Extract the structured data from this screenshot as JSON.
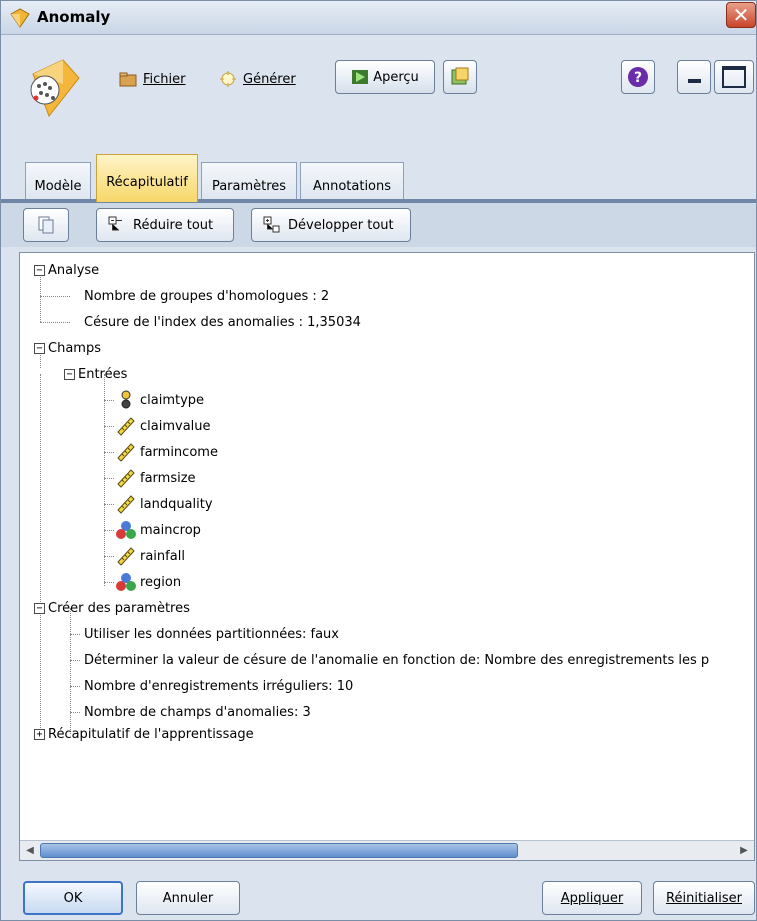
{
  "window": {
    "title": "Anomaly"
  },
  "menu": {
    "file": "Fichier",
    "generate": "Générer",
    "preview": "Aperçu"
  },
  "tabs": [
    {
      "label": "Modèle"
    },
    {
      "label": "Récapitulatif"
    },
    {
      "label": "Paramètres"
    },
    {
      "label": "Annotations"
    }
  ],
  "actions": {
    "collapse_all": "Réduire tout",
    "expand_all": "Développer tout"
  },
  "tree": {
    "analysis": "Analyse",
    "peer_groups": "Nombre de groupes d'homologues : 2",
    "cutoff": "Césure de l'index des anomalies : 1,35034",
    "fields": "Champs",
    "inputs": "Entrées",
    "field_items": [
      {
        "name": "claimtype",
        "icon": "flag-icon"
      },
      {
        "name": "claimvalue",
        "icon": "ruler-icon"
      },
      {
        "name": "farmincome",
        "icon": "ruler-icon"
      },
      {
        "name": "farmsize",
        "icon": "ruler-icon"
      },
      {
        "name": "landquality",
        "icon": "ruler-icon"
      },
      {
        "name": "maincrop",
        "icon": "set-icon"
      },
      {
        "name": "rainfall",
        "icon": "ruler-icon"
      },
      {
        "name": "region",
        "icon": "set-icon"
      }
    ],
    "build_settings": "Créer des paramètres",
    "settings": [
      "Utiliser les données partitionnées: faux",
      "Déterminer la valeur de césure de l'anomalie en fonction de: Nombre des enregistrements les p",
      "Nombre d'enregistrements irréguliers: 10",
      "Nombre de champs d'anomalies: 3"
    ],
    "training_summary": "Récapitulatif de l'apprentissage"
  },
  "buttons": {
    "ok": "OK",
    "cancel": "Annuler",
    "apply": "Appliquer",
    "reset": "Réinitialiser"
  },
  "colors": {
    "accent": "#3c75c7",
    "active_tab": "#f7d769"
  }
}
